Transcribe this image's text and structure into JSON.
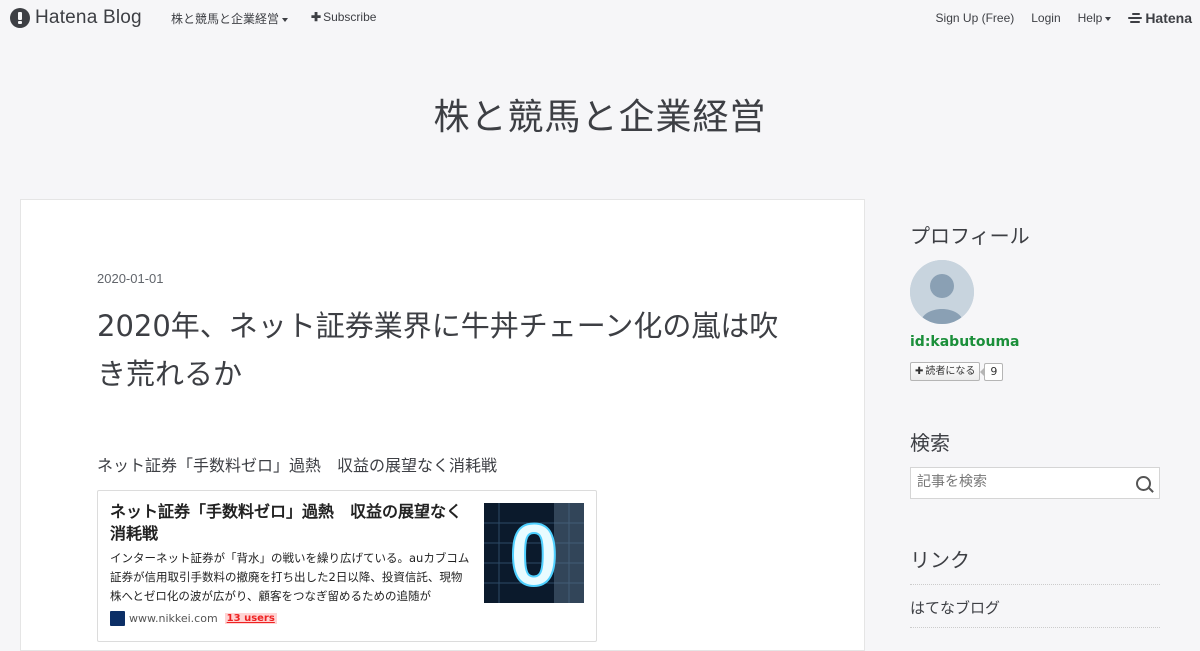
{
  "topbar": {
    "logo_text": "Hatena Blog",
    "blog_menu": "株と競馬と企業経営",
    "subscribe": "Subscribe",
    "signup": "Sign Up (Free)",
    "login": "Login",
    "help": "Help",
    "hatena": "Hatena"
  },
  "blog": {
    "title": "株と競馬と企業経営"
  },
  "entry": {
    "date": "2020-01-01",
    "title": "2020年、ネット証券業界に牛丼チェーン化の嵐は吹き荒れるか",
    "subtitle": "ネット証券「手数料ゼロ」過熱　収益の展望なく消耗戦",
    "card": {
      "title": "ネット証券「手数料ゼロ」過熱　収益の展望なく消耗戦",
      "description": "インターネット証券が「背水」の戦いを繰り広げている。auカブコム証券が信用取引手数料の撤廃を打ち出した2日以降、投資信託、現物株へとゼロ化の波が広がり、顧客をつなぎ留めるための追随が",
      "thumb_text": "0",
      "site": "www.nikkei.com",
      "users": "13 users"
    }
  },
  "sidebar": {
    "profile_heading": "プロフィール",
    "profile_id": "id:kabutouma",
    "reader_button": "読者になる",
    "reader_count": "9",
    "search_heading": "検索",
    "search_placeholder": "記事を検索",
    "links_heading": "リンク",
    "links": [
      "はてなブログ"
    ]
  },
  "colors": {
    "background": "#f6f6f8",
    "text": "#3d3f44",
    "profile_id": "#1b8f3a",
    "users_badge": "#e22222"
  },
  "icons": [
    "hatena-blog-logo-icon",
    "caret-down-icon",
    "plus-icon",
    "hatena-logo-icon",
    "avatar-icon",
    "search-icon",
    "nikkei-favicon-icon"
  ]
}
